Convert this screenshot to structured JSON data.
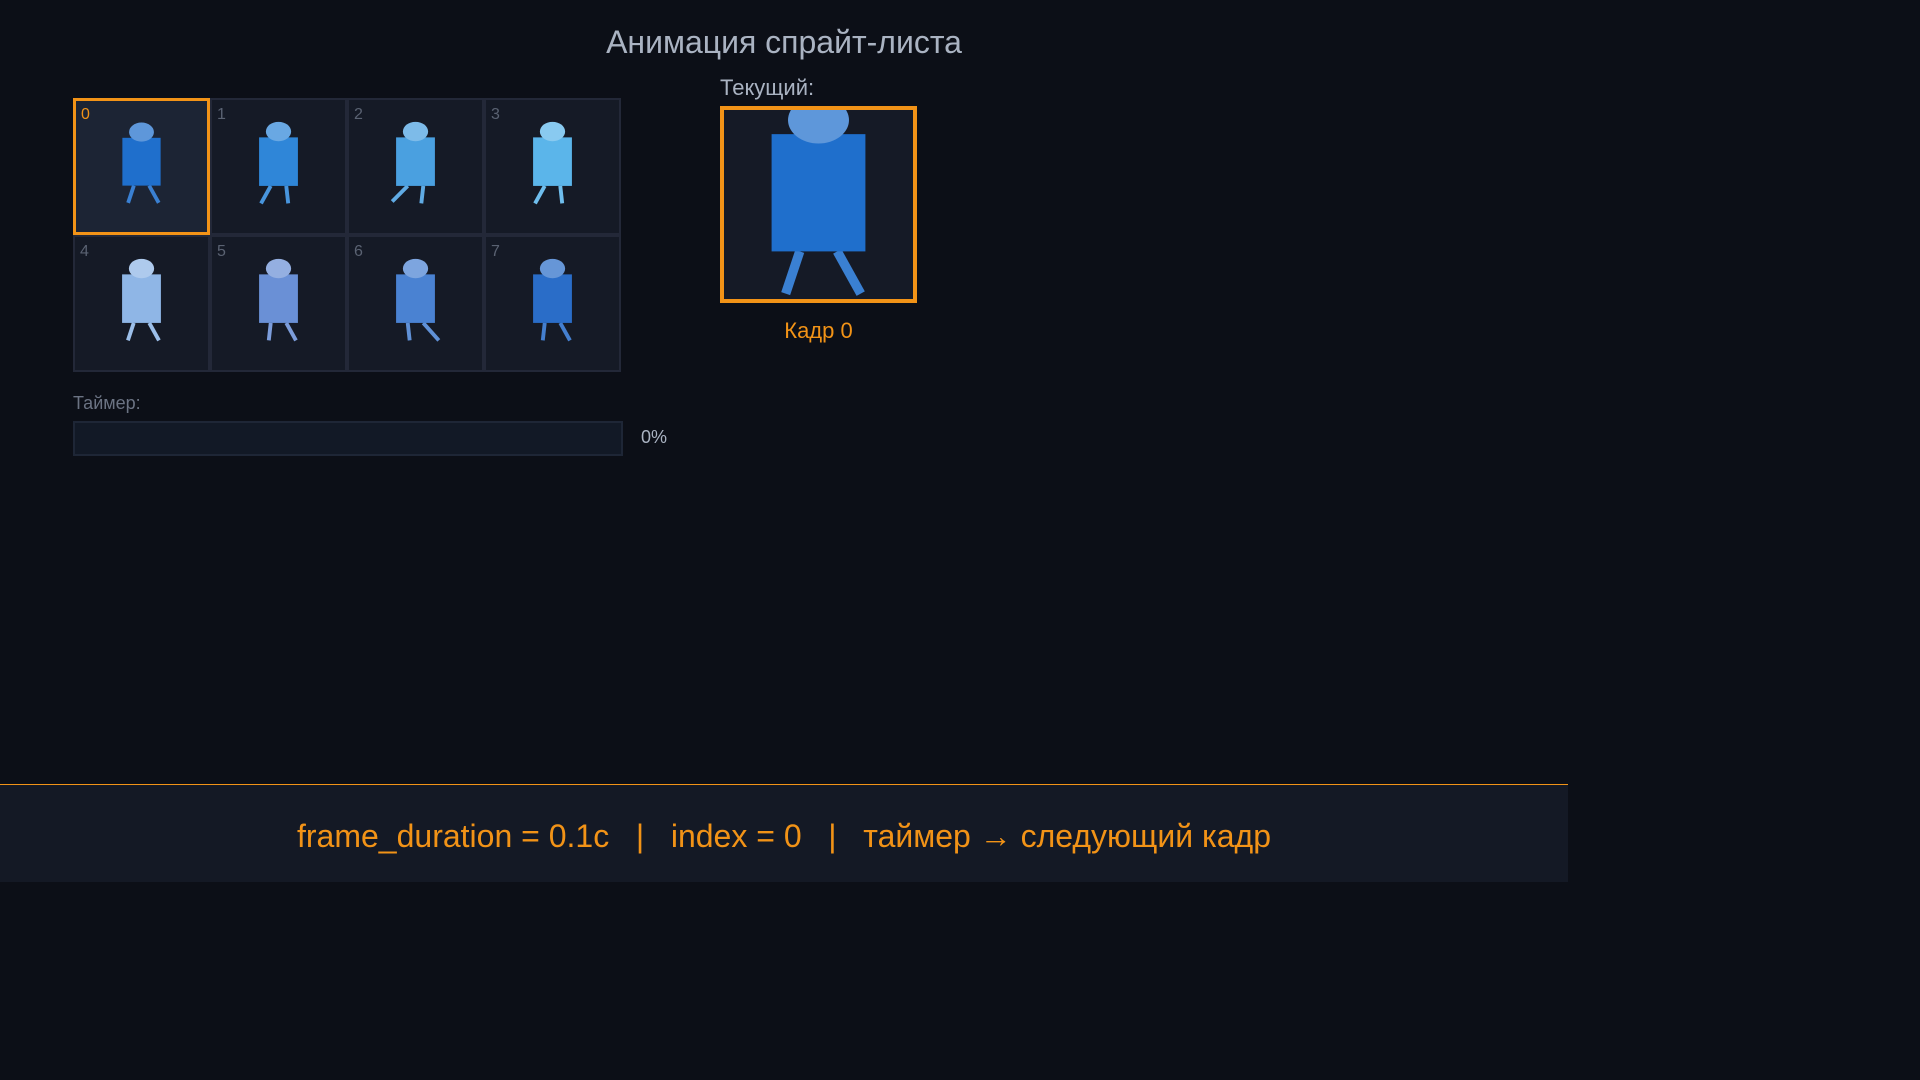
{
  "title": "Анимация спрайт-листа",
  "frames": [
    {
      "label": "0",
      "color": "#1f6fcc",
      "pose": "stand"
    },
    {
      "label": "1",
      "color": "#2f86d8",
      "pose": "step-left"
    },
    {
      "label": "2",
      "color": "#4aa0e0",
      "pose": "stride-left"
    },
    {
      "label": "3",
      "color": "#5bb5ea",
      "pose": "step-left"
    },
    {
      "label": "4",
      "color": "#8fb6e6",
      "pose": "stand"
    },
    {
      "label": "5",
      "color": "#6a90d6",
      "pose": "step-right"
    },
    {
      "label": "6",
      "color": "#4a82d2",
      "pose": "stride-right"
    },
    {
      "label": "7",
      "color": "#2a6dc8",
      "pose": "step-right"
    }
  ],
  "selected_index": 0,
  "timer": {
    "label": "Таймер:",
    "percent_text": "0%",
    "fraction": 0
  },
  "current": {
    "label": "Текущий:",
    "frame_label": "Кадр 0"
  },
  "footer": {
    "text": "frame_duration = 0.1с   |   index = 0   |   таймер → следующий кадр"
  },
  "colors": {
    "accent": "#f29317",
    "background": "#0c0f17",
    "cell": "#151a26"
  }
}
